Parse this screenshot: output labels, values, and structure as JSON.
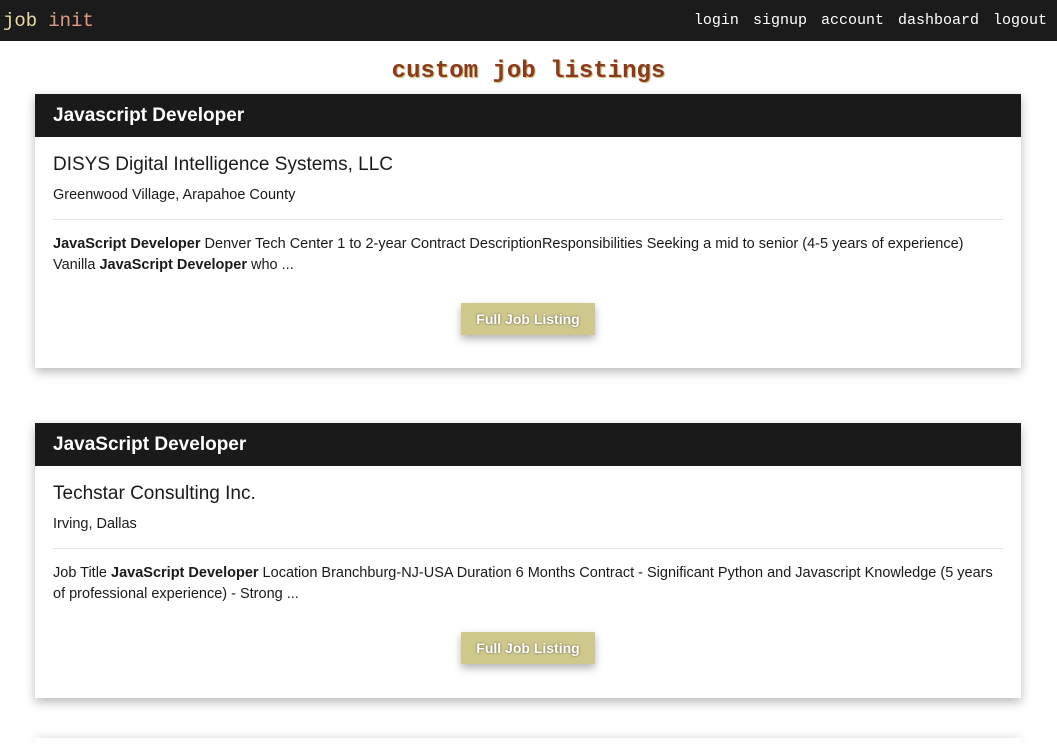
{
  "nav": {
    "brand_part1": "job",
    "brand_part2": "init",
    "links": [
      "login",
      "signup",
      "account",
      "dashboard",
      "logout"
    ]
  },
  "page": {
    "title": "custom job listings"
  },
  "listings": [
    {
      "title": "Javascript Developer",
      "company": "DISYS Digital Intelligence Systems, LLC",
      "location": "Greenwood Village, Arapahoe County",
      "desc": {
        "b1": "JavaScript Developer",
        "t1": " Denver Tech Center 1 to 2-year Contract DescriptionResponsibilities Seeking a mid to senior (4-5 years of experience) Vanilla ",
        "b2": "JavaScript Developer",
        "t2": " who ..."
      },
      "button": "Full Job Listing"
    },
    {
      "title": "JavaScript Developer",
      "company": "Techstar Consulting Inc.",
      "location": "Irving, Dallas",
      "desc": {
        "t0": "Job Title ",
        "b1": "JavaScript Developer",
        "t1": " Location Branchburg-NJ-USA Duration 6 Months Contract - Significant Python and Javascript Knowledge (5 years of professional experience) - Strong ..."
      },
      "button": "Full Job Listing"
    }
  ]
}
